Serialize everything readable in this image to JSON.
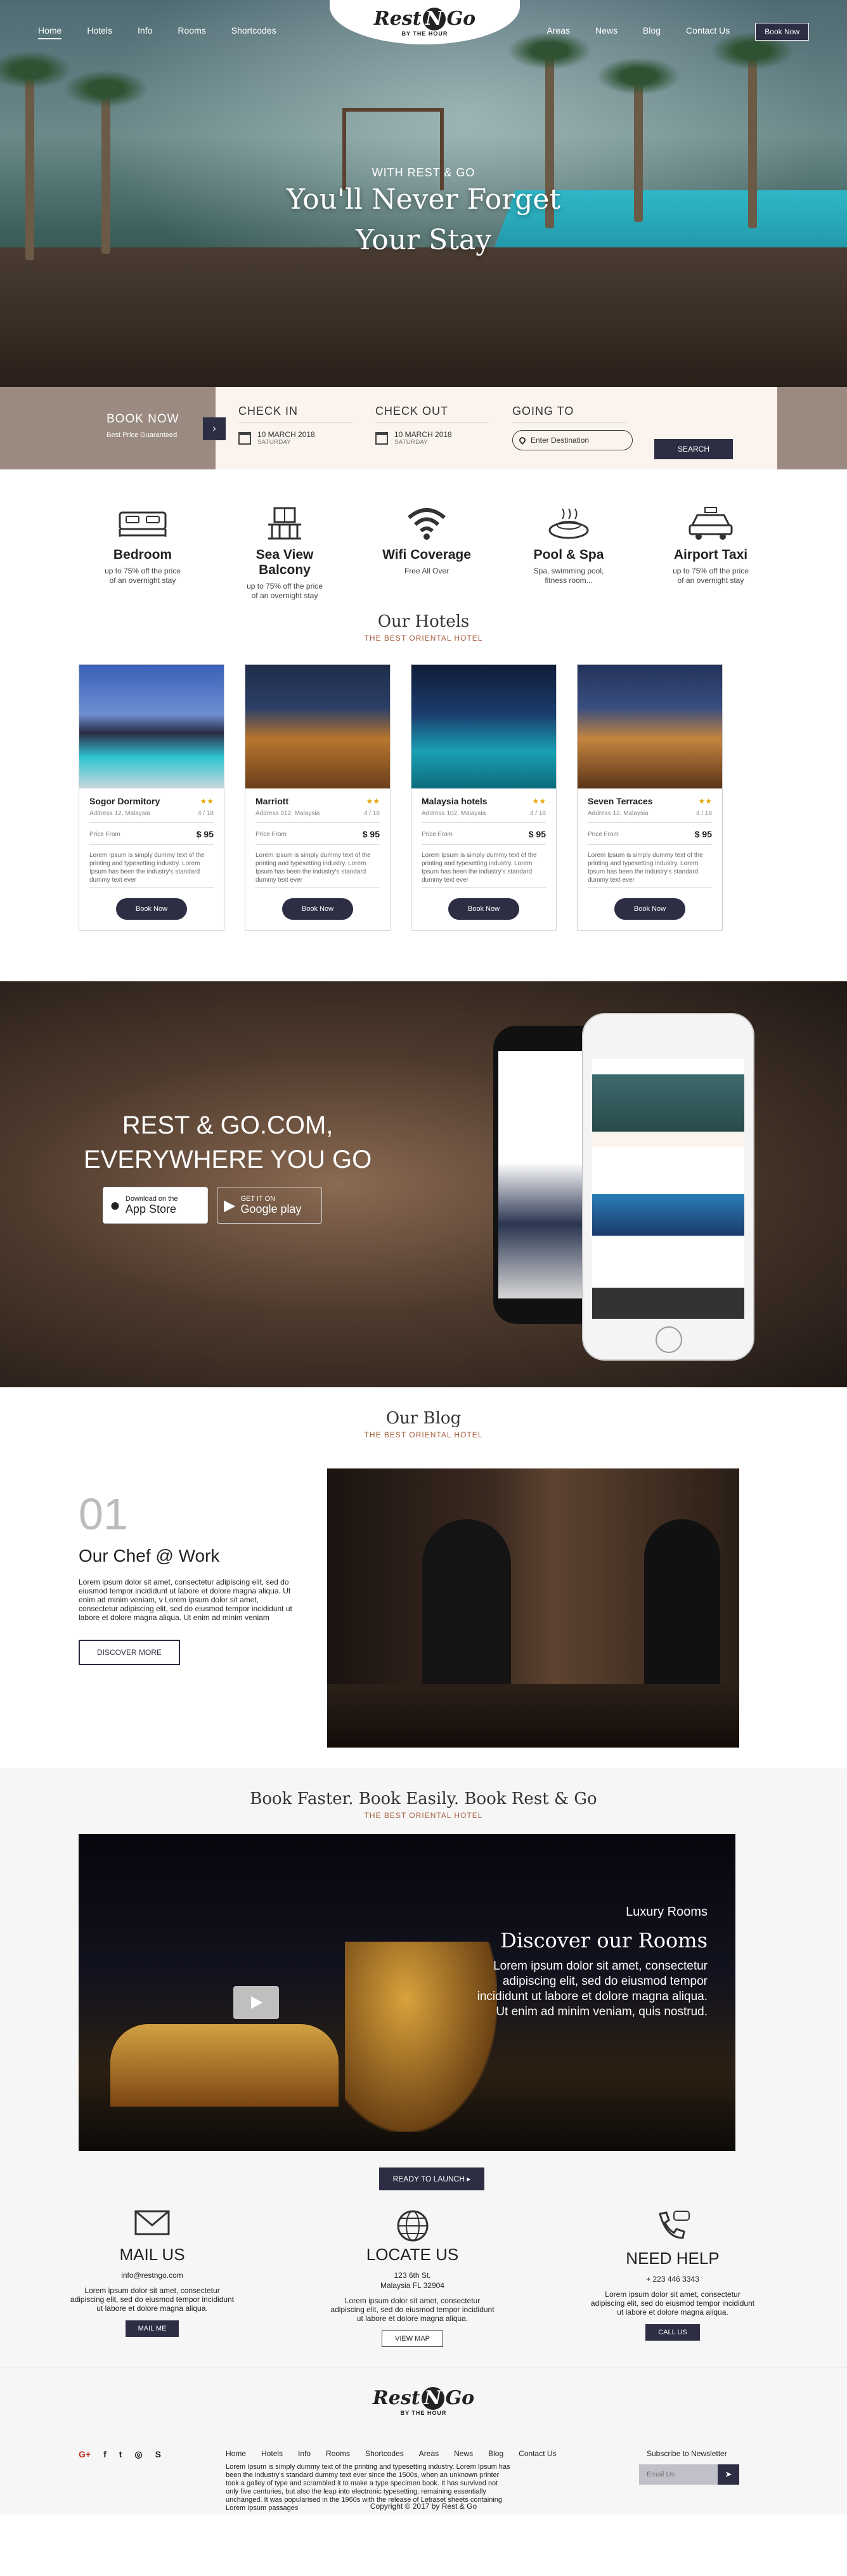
{
  "nav": {
    "left": [
      "Home",
      "Hotels",
      "Info",
      "Rooms",
      "Shortcodes"
    ],
    "right": [
      "Areas",
      "News",
      "Blog",
      "Contact Us"
    ],
    "book_now": "Book Now"
  },
  "logo": {
    "part1": "Rest",
    "mid": "N",
    "part2": "Go",
    "tagline": "BY THE HOUR"
  },
  "hero": {
    "kicker": "WITH REST & GO",
    "line1": "You'll Never Forget",
    "line2": "Your Stay"
  },
  "booking": {
    "title": "BOOK NOW",
    "subtitle": "Best Price Guaranteed",
    "check_in": {
      "label": "CHECK IN",
      "date": "10 MARCH 2018",
      "day": "SATURDAY"
    },
    "check_out": {
      "label": "CHECK OUT",
      "date": "10 MARCH 2018",
      "day": "SATURDAY"
    },
    "going_to": {
      "label": "GOING TO",
      "placeholder": "Enter Destination"
    },
    "search": "SEARCH"
  },
  "amenities": [
    {
      "title": "Bedroom",
      "desc1": "up to 75% off the price",
      "desc2": "of an overnight stay",
      "icon": "bed-icon"
    },
    {
      "title": "Sea View Balcony",
      "desc1": "up to 75% off the price",
      "desc2": "of an overnight stay",
      "icon": "balcony-icon"
    },
    {
      "title": "Wifi Coverage",
      "desc1": "Free All Over",
      "desc2": "",
      "icon": "wifi-icon"
    },
    {
      "title": "Pool & Spa",
      "desc1": "Spa, swimming pool,",
      "desc2": "fitness room...",
      "icon": "spa-icon"
    },
    {
      "title": "Airport Taxi",
      "desc1": "up to 75% off the price",
      "desc2": "of an overnight stay",
      "icon": "taxi-icon"
    }
  ],
  "hotels_section": {
    "title": "Our Hotels",
    "subtitle": "THE BEST ORIENTAL HOTEL"
  },
  "hotels": [
    {
      "name": "Sogor Dormitory",
      "address": "Address 12, Malaysia",
      "rating": "4 / 18",
      "price_label": "Price From",
      "price": "$ 95",
      "desc": "Lorem Ipsum is simply dummy text of the printing and typesetting industry. Lorem Ipsum has been the industry's standard dummy text ever",
      "button": "Book Now"
    },
    {
      "name": "Marriott",
      "address": "Address 012, Malaysia",
      "rating": "4 / 18",
      "price_label": "Price From",
      "price": "$ 95",
      "desc": "Lorem Ipsum is simply dummy text of the printing and typesetting industry. Lorem Ipsum has been the industry's standard dummy text ever",
      "button": "Book Now"
    },
    {
      "name": "Malaysia hotels",
      "address": "Address 102, Malaysia",
      "rating": "4 / 18",
      "price_label": "Price From",
      "price": "$ 95",
      "desc": "Lorem Ipsum is simply dummy text of the printing and typesetting industry. Lorem Ipsum has been the industry's standard dummy text ever",
      "button": "Book Now"
    },
    {
      "name": "Seven Terraces",
      "address": "Address 12, Malaysia",
      "rating": "4 / 18",
      "price_label": "Price From",
      "price": "$ 95",
      "desc": "Lorem Ipsum is simply dummy text of the printing and typesetting industry. Lorem Ipsum has been the industry's standard dummy text ever",
      "button": "Book Now"
    }
  ],
  "app": {
    "line1": "REST & GO.COM,",
    "line2": "EVERYWHERE YOU GO",
    "appstore_small": "Download on the",
    "appstore_big": "App Store",
    "play_small": "GET IT ON",
    "play_big": "Google play"
  },
  "blog": {
    "title": "Our Blog",
    "subtitle": "THE BEST ORIENTAL HOTEL",
    "number": "01",
    "post_title": "Our Chef @ Work",
    "post_text": "Lorem ipsum dolor sit amet, consectetur adipiscing elit, sed do eiusmod tempor incididunt ut labore et dolore magna aliqua. Ut enim ad minim veniam, v Lorem ipsum dolor sit amet, consectetur adipiscing elit, sed do eiusmod tempor incididunt ut labore et dolore magna aliqua. Ut enim ad minim veniam",
    "button": "DISCOVER MORE"
  },
  "rooms": {
    "title": "Book Faster. Book Easily. Book Rest & Go",
    "subtitle": "THE BEST ORIENTAL HOTEL",
    "kicker": "Luxury Rooms",
    "heading": "Discover our Rooms",
    "text": "Lorem ipsum dolor sit amet, consectetur adipiscing elit, sed do eiusmod tempor incididunt ut labore et dolore magna aliqua. Ut enim ad minim veniam, quis nostrud.",
    "launch": "READY TO LAUNCH"
  },
  "contact": [
    {
      "title": "MAIL US",
      "line1": "info@restngo.com",
      "line2": "",
      "text": "Lorem ipsum dolor sit amet, consectetur adipiscing elit, sed do eiusmod tempor incididunt ut labore et dolore magna aliqua.",
      "button": "MAIL ME",
      "icon": "mail-icon"
    },
    {
      "title": "LOCATE US",
      "line1": "123 6th St.",
      "line2": "Malaysia FL 32904",
      "text": "Lorem ipsum dolor sit amet, consectetur adipiscing elit, sed do eiusmod tempor incididunt ut labore et dolore magna aliqua.",
      "button": "VIEW MAP",
      "icon": "globe-icon"
    },
    {
      "title": "NEED HELP",
      "line1": "+ 223 446 3343",
      "line2": "",
      "text": "Lorem ipsum dolor sit amet, consectetur adipiscing elit, sed do eiusmod tempor incididunt ut labore et dolore magna aliqua.",
      "button": "CALL US",
      "icon": "phone-icon"
    }
  ],
  "footer": {
    "social": [
      "G+",
      "f",
      "t",
      "◎",
      "S"
    ],
    "nav": [
      "Home",
      "Hotels",
      "Info",
      "Rooms",
      "Shortcodes",
      "Areas",
      "News",
      "Blog",
      "Contact Us"
    ],
    "text": "Lorem Ipsum is simply dummy text of the printing and typesetting industry. Lorem Ipsum has been the industry's standard dummy text ever since the 1500s, when an unknown printer took a galley of type and scrambled it to make a type specimen book. It has survived not only five centuries, but also the leap into electronic typesetting, remaining essentially unchanged. It was popularised in the 1960s with the release of Letraset sheets containing Lorem Ipsum passages",
    "newsletter": "Subscribe to Newsletter",
    "email_placeholder": "Email Us",
    "copyright": "Copyright © 2017 by Rest & Go"
  },
  "colors": {
    "navy": "#2d2e44",
    "taupe": "#9a8a80",
    "accent": "#a65d3a",
    "star": "#e5a100"
  }
}
